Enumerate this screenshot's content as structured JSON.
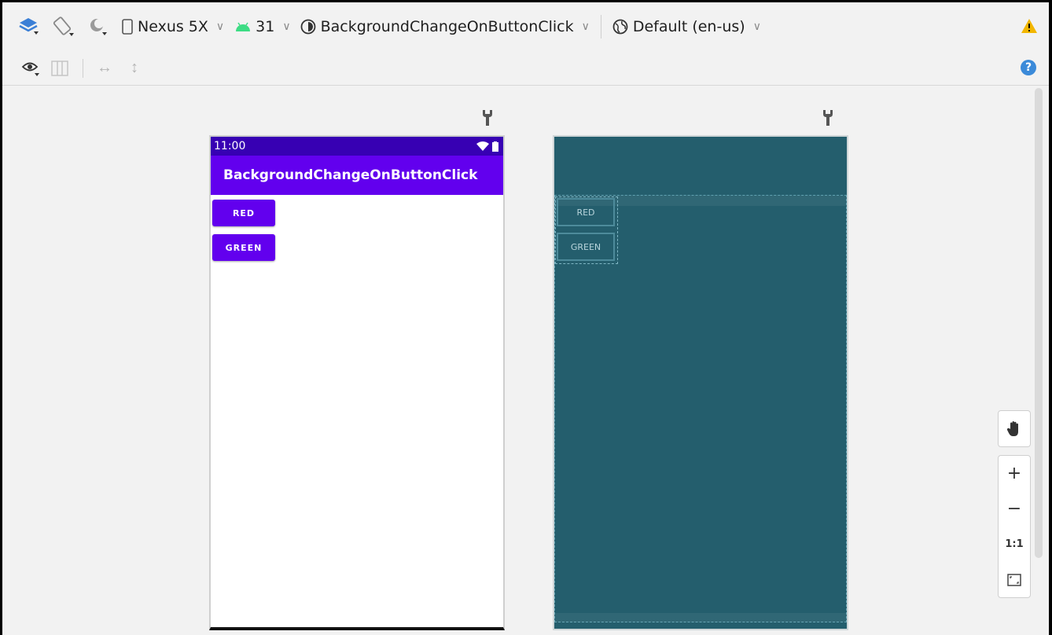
{
  "toolbar": {
    "device": "Nexus 5X",
    "api_level": "31",
    "theme": "BackgroundChangeOnButtonClick",
    "locale": "Default (en-us)"
  },
  "phone": {
    "time": "11:00",
    "app_title": "BackgroundChangeOnButtonClick",
    "buttons": [
      "RED",
      "GREEN"
    ]
  },
  "blueprint": {
    "buttons": [
      "RED",
      "GREEN"
    ]
  },
  "zoom": {
    "actual_size_label": "1:1"
  },
  "colors": {
    "accent": "#6200ee",
    "status_bar": "#3700b3",
    "blueprint": "#245e6d",
    "android_green": "#3ddc84",
    "warning": "#f2b600",
    "help": "#3b8ad9"
  }
}
